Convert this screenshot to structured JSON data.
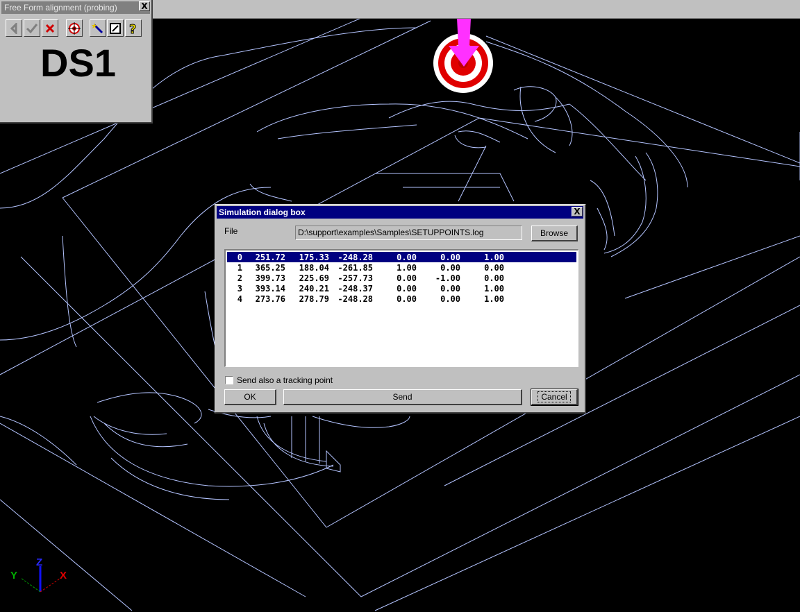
{
  "tool_window": {
    "title": "Free Form alignment (probing)",
    "close_glyph": "X",
    "toolbar": [
      "back-arrow-icon",
      "check-icon",
      "red-x-icon",
      "target-icon",
      "wand-icon",
      "frame-icon",
      "help-icon"
    ],
    "datum_label": "DS1"
  },
  "dialog": {
    "title": "Simulation dialog box",
    "close_glyph": "X",
    "file_label": "File",
    "file_path": "D:\\support\\examples\\Samples\\SETUPPOINTS.log",
    "browse_label": "Browse",
    "points": [
      [
        "0",
        "251.72",
        "175.33",
        "-248.28",
        "0.00",
        "0.00",
        "1.00"
      ],
      [
        "1",
        "365.25",
        "188.04",
        "-261.85",
        "1.00",
        "0.00",
        "0.00"
      ],
      [
        "2",
        "399.73",
        "225.69",
        "-257.73",
        "0.00",
        "-1.00",
        "0.00"
      ],
      [
        "3",
        "393.14",
        "240.21",
        "-248.37",
        "0.00",
        "0.00",
        "1.00"
      ],
      [
        "4",
        "273.76",
        "278.79",
        "-248.28",
        "0.00",
        "0.00",
        "1.00"
      ]
    ],
    "selected_row": 0,
    "tracking_label": "Send also a tracking point",
    "tracking_checked": false,
    "ok_label": "OK",
    "send_label": "Send",
    "cancel_label": "Cancel"
  },
  "axis_triad": {
    "z": "Z",
    "y": "Y",
    "x": "X"
  },
  "colors": {
    "wireframe": "#b4c4ff",
    "probe": "#ff30ff",
    "target_red": "#e00000",
    "selection": "#000080",
    "background": "#000000"
  }
}
